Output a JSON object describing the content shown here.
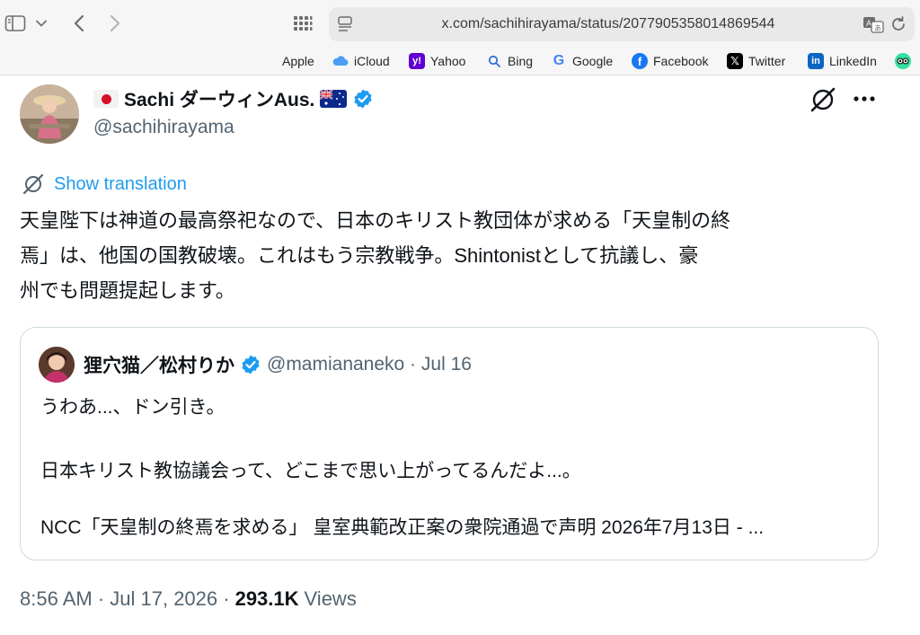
{
  "browser": {
    "url": "x.com/sachihirayama/status/2077905358014869544",
    "favorites": [
      {
        "label": "Apple",
        "icon": "apple-icon"
      },
      {
        "label": "iCloud",
        "icon": "icloud-icon"
      },
      {
        "label": "Yahoo",
        "icon": "yahoo-icon"
      },
      {
        "label": "Bing",
        "icon": "search-icon"
      },
      {
        "label": "Google",
        "icon": "google-icon"
      },
      {
        "label": "Facebook",
        "icon": "facebook-icon"
      },
      {
        "label": "Twitter",
        "icon": "x-icon"
      },
      {
        "label": "LinkedIn",
        "icon": "linkedin-icon"
      }
    ]
  },
  "tweet": {
    "author_name": "Sachi ダーウィンAus.",
    "handle": "@sachihirayama",
    "translate_label": "Show translation",
    "text_lines": [
      "天皇陛下は神道の最高祭祀なので、日本のキリスト教団体が求める「天皇制の終",
      "焉」は、他国の国教破壊。これはもう宗教戦争。Shintonistとして抗議し、豪",
      "州でも問題提起します。"
    ],
    "time": "8:56 AM · Jul 17, 2026 ·",
    "views_count": "293.1K",
    "views_label": "Views"
  },
  "quote": {
    "author_name": "狸穴猫／松村りか",
    "handle_date": "@mamiananeko · Jul 16",
    "line1": "うわあ...、ドン引き。",
    "line2": "日本キリスト教協議会って、どこまで思い上がってるんだよ...。",
    "line3": "NCC「天皇制の終焉を求める」 皇室典範改正案の衆院通過で声明 2026年7月13日 - ..."
  },
  "colors": {
    "accent": "#1d9bf0",
    "secondary_text": "#536471",
    "border": "#cfd9de"
  }
}
